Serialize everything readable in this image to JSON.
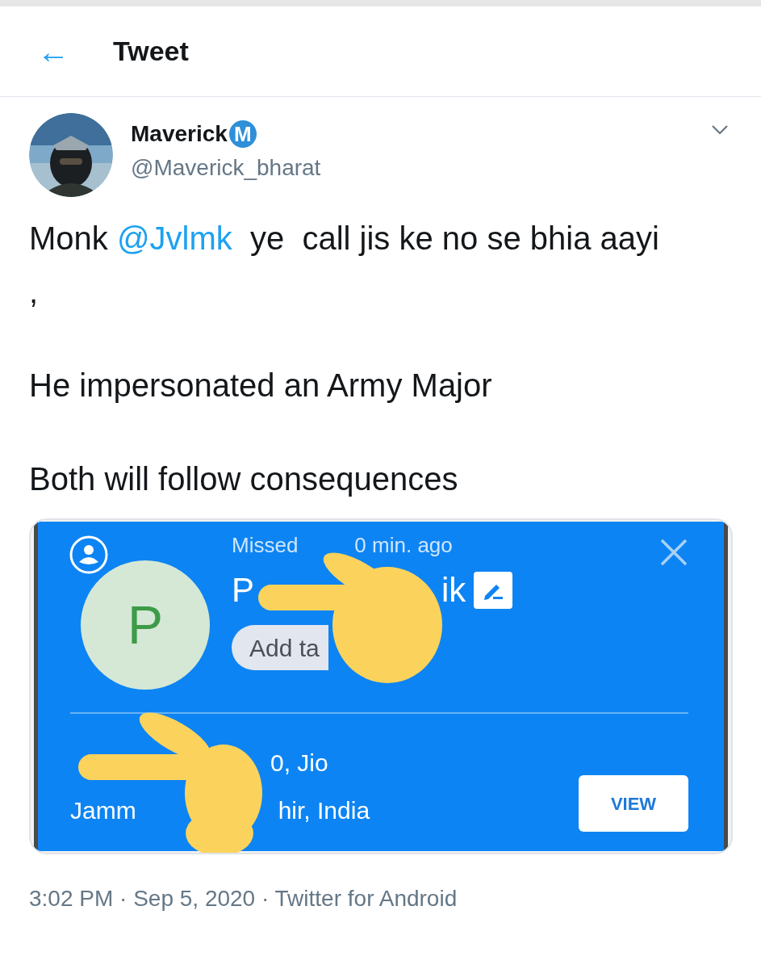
{
  "header": {
    "back": "←",
    "title": "Tweet"
  },
  "author": {
    "name": "Maverick",
    "badge": "M",
    "handle": "@Maverick_bharat"
  },
  "paragraphs": [
    [
      {
        "kind": "text",
        "text": "Monk "
      },
      {
        "kind": "mention",
        "text": "@Jvlmk"
      },
      {
        "kind": "text",
        "text": "  ye  call jis ke no se bhia aayi ,"
      }
    ],
    [
      {
        "kind": "text",
        "text": "He impersonated an Army Major"
      }
    ],
    [
      {
        "kind": "text",
        "text": "Both will follow consequences"
      }
    ]
  ],
  "media": {
    "avatar_letter": "P",
    "status_parts": [
      "Missed",
      "0 min. ago"
    ],
    "name_parts": [
      "P",
      "ik"
    ],
    "tag_button": "Add ta",
    "number_parts": [
      "0, Jio"
    ],
    "location_parts": [
      "Jamm",
      "hir, India"
    ],
    "view_button": "VIEW"
  },
  "timestamp": "3:02 PM · Sep 5, 2020 · Twitter for Android"
}
